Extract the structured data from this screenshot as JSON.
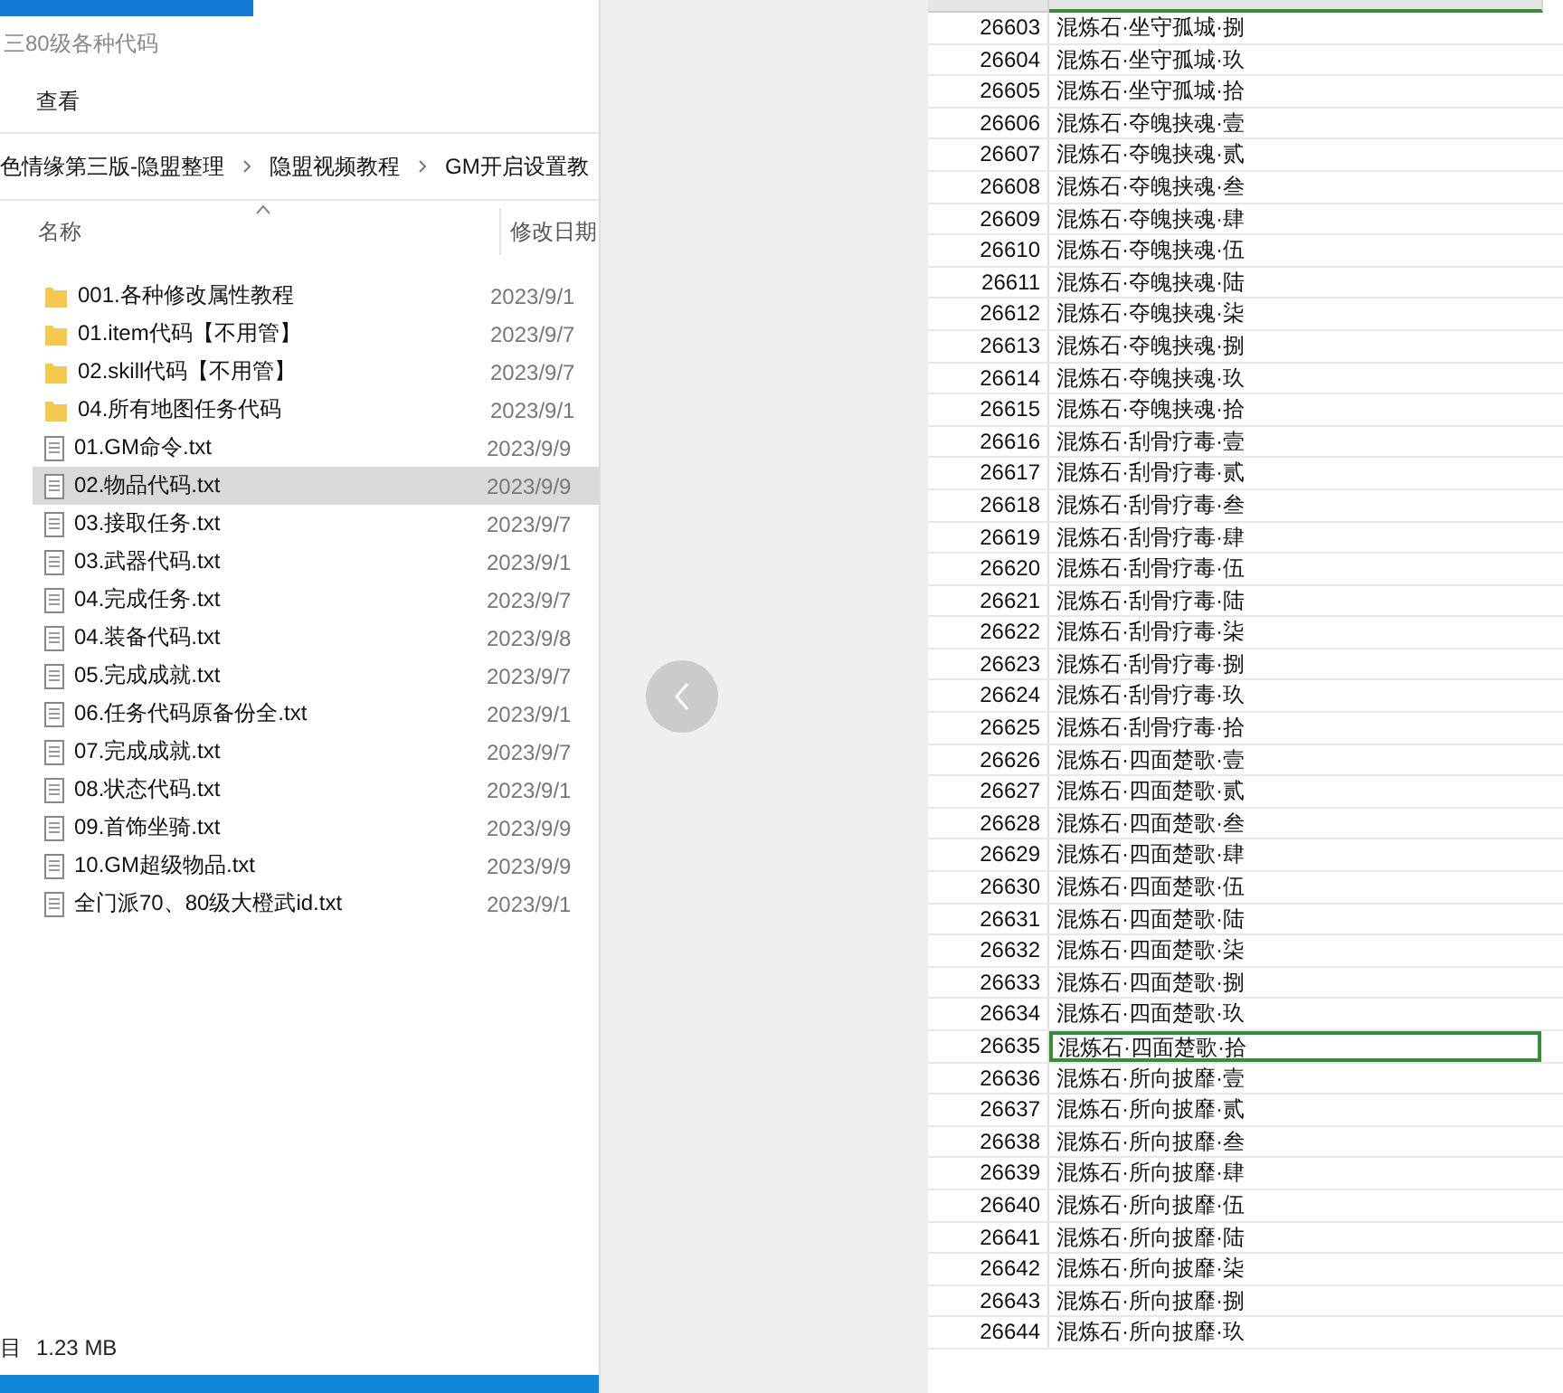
{
  "explorer": {
    "title": "三80级各种代码",
    "ribbon_tabs": [
      {
        "label": "查看",
        "selected": false
      }
    ],
    "breadcrumb": [
      "色情缘第三版-隐盟整理",
      "隐盟视频教程",
      "GM开启设置教"
    ],
    "columns": [
      {
        "label": "名称",
        "sorted": true
      },
      {
        "label": "修改日期",
        "sorted": false
      }
    ],
    "files": [
      {
        "kind": "folder",
        "name": "001.各种修改属性教程",
        "date": "2023/9/1",
        "selected": false
      },
      {
        "kind": "folder",
        "name": "01.item代码【不用管】",
        "date": "2023/9/7",
        "selected": false
      },
      {
        "kind": "folder",
        "name": "02.skill代码【不用管】",
        "date": "2023/9/7",
        "selected": false
      },
      {
        "kind": "folder",
        "name": "04.所有地图任务代码",
        "date": "2023/9/1",
        "selected": false
      },
      {
        "kind": "file",
        "name": "01.GM命令.txt",
        "date": "2023/9/9",
        "selected": false
      },
      {
        "kind": "file",
        "name": "02.物品代码.txt",
        "date": "2023/9/9",
        "selected": true
      },
      {
        "kind": "file",
        "name": "03.接取任务.txt",
        "date": "2023/9/7",
        "selected": false
      },
      {
        "kind": "file",
        "name": "03.武器代码.txt",
        "date": "2023/9/1",
        "selected": false
      },
      {
        "kind": "file",
        "name": "04.完成任务.txt",
        "date": "2023/9/7",
        "selected": false
      },
      {
        "kind": "file",
        "name": "04.装备代码.txt",
        "date": "2023/9/8",
        "selected": false
      },
      {
        "kind": "file",
        "name": "05.完成成就.txt",
        "date": "2023/9/7",
        "selected": false
      },
      {
        "kind": "file",
        "name": "06.任务代码原备份全.txt",
        "date": "2023/9/1",
        "selected": false
      },
      {
        "kind": "file",
        "name": "07.完成成就.txt",
        "date": "2023/9/7",
        "selected": false
      },
      {
        "kind": "file",
        "name": "08.状态代码.txt",
        "date": "2023/9/1",
        "selected": false
      },
      {
        "kind": "file",
        "name": "09.首饰坐骑.txt",
        "date": "2023/9/9",
        "selected": false
      },
      {
        "kind": "file",
        "name": "10.GM超级物品.txt",
        "date": "2023/9/9",
        "selected": false
      },
      {
        "kind": "file",
        "name": "全门派70、80级大橙武id.txt",
        "date": "2023/9/1",
        "selected": false
      }
    ],
    "status": [
      "目",
      "1.23 MB"
    ]
  },
  "sheet": {
    "rows": [
      {
        "id": "26603",
        "name": "混炼石·坐守孤城·捌",
        "selected": false
      },
      {
        "id": "26604",
        "name": "混炼石·坐守孤城·玖",
        "selected": false
      },
      {
        "id": "26605",
        "name": "混炼石·坐守孤城·拾",
        "selected": false
      },
      {
        "id": "26606",
        "name": "混炼石·夺魄挟魂·壹",
        "selected": false
      },
      {
        "id": "26607",
        "name": "混炼石·夺魄挟魂·贰",
        "selected": false
      },
      {
        "id": "26608",
        "name": "混炼石·夺魄挟魂·叁",
        "selected": false
      },
      {
        "id": "26609",
        "name": "混炼石·夺魄挟魂·肆",
        "selected": false
      },
      {
        "id": "26610",
        "name": "混炼石·夺魄挟魂·伍",
        "selected": false
      },
      {
        "id": "26611",
        "name": "混炼石·夺魄挟魂·陆",
        "selected": false
      },
      {
        "id": "26612",
        "name": "混炼石·夺魄挟魂·柒",
        "selected": false
      },
      {
        "id": "26613",
        "name": "混炼石·夺魄挟魂·捌",
        "selected": false
      },
      {
        "id": "26614",
        "name": "混炼石·夺魄挟魂·玖",
        "selected": false
      },
      {
        "id": "26615",
        "name": "混炼石·夺魄挟魂·拾",
        "selected": false
      },
      {
        "id": "26616",
        "name": "混炼石·刮骨疗毒·壹",
        "selected": false
      },
      {
        "id": "26617",
        "name": "混炼石·刮骨疗毒·贰",
        "selected": false
      },
      {
        "id": "26618",
        "name": "混炼石·刮骨疗毒·叁",
        "selected": false
      },
      {
        "id": "26619",
        "name": "混炼石·刮骨疗毒·肆",
        "selected": false
      },
      {
        "id": "26620",
        "name": "混炼石·刮骨疗毒·伍",
        "selected": false
      },
      {
        "id": "26621",
        "name": "混炼石·刮骨疗毒·陆",
        "selected": false
      },
      {
        "id": "26622",
        "name": "混炼石·刮骨疗毒·柒",
        "selected": false
      },
      {
        "id": "26623",
        "name": "混炼石·刮骨疗毒·捌",
        "selected": false
      },
      {
        "id": "26624",
        "name": "混炼石·刮骨疗毒·玖",
        "selected": false
      },
      {
        "id": "26625",
        "name": "混炼石·刮骨疗毒·拾",
        "selected": false
      },
      {
        "id": "26626",
        "name": "混炼石·四面楚歌·壹",
        "selected": false
      },
      {
        "id": "26627",
        "name": "混炼石·四面楚歌·贰",
        "selected": false
      },
      {
        "id": "26628",
        "name": "混炼石·四面楚歌·叁",
        "selected": false
      },
      {
        "id": "26629",
        "name": "混炼石·四面楚歌·肆",
        "selected": false
      },
      {
        "id": "26630",
        "name": "混炼石·四面楚歌·伍",
        "selected": false
      },
      {
        "id": "26631",
        "name": "混炼石·四面楚歌·陆",
        "selected": false
      },
      {
        "id": "26632",
        "name": "混炼石·四面楚歌·柒",
        "selected": false
      },
      {
        "id": "26633",
        "name": "混炼石·四面楚歌·捌",
        "selected": false
      },
      {
        "id": "26634",
        "name": "混炼石·四面楚歌·玖",
        "selected": false
      },
      {
        "id": "26635",
        "name": "混炼石·四面楚歌·拾",
        "selected": true
      },
      {
        "id": "26636",
        "name": "混炼石·所向披靡·壹",
        "selected": false
      },
      {
        "id": "26637",
        "name": "混炼石·所向披靡·贰",
        "selected": false
      },
      {
        "id": "26638",
        "name": "混炼石·所向披靡·叁",
        "selected": false
      },
      {
        "id": "26639",
        "name": "混炼石·所向披靡·肆",
        "selected": false
      },
      {
        "id": "26640",
        "name": "混炼石·所向披靡·伍",
        "selected": false
      },
      {
        "id": "26641",
        "name": "混炼石·所向披靡·陆",
        "selected": false
      },
      {
        "id": "26642",
        "name": "混炼石·所向披靡·柒",
        "selected": false
      },
      {
        "id": "26643",
        "name": "混炼石·所向披靡·捌",
        "selected": false
      },
      {
        "id": "26644",
        "name": "混炼石·所向披靡·玖",
        "selected": false
      }
    ]
  }
}
